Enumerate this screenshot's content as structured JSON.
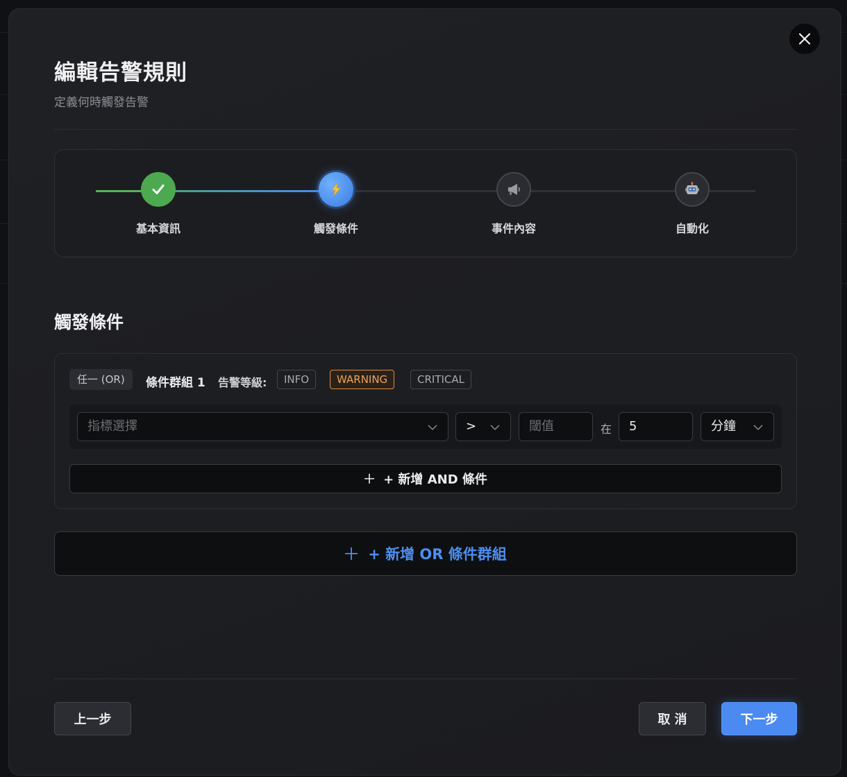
{
  "modal": {
    "title": "編輯告警規則",
    "subtitle": "定義何時觸發告警"
  },
  "steps": [
    {
      "label": "基本資訊",
      "status": "completed",
      "icon": "check-icon"
    },
    {
      "label": "觸發條件",
      "status": "active",
      "icon": "lightning-icon"
    },
    {
      "label": "事件內容",
      "status": "pending",
      "icon": "megaphone-icon"
    },
    {
      "label": "自動化",
      "status": "pending",
      "icon": "robot-icon"
    }
  ],
  "section": {
    "title": "觸發條件"
  },
  "condition_group": {
    "logic_badge": "任一 (OR)",
    "name": "條件群組 1",
    "level_label": "告警等級:",
    "levels": [
      "INFO",
      "WARNING",
      "CRITICAL"
    ],
    "selected_level": "WARNING",
    "metric_placeholder": "指標選擇",
    "operator": ">",
    "threshold_placeholder": "閾值",
    "within_label": "在",
    "duration_value": "5",
    "duration_unit": "分鐘",
    "add_and_label": "+ 新增 AND 條件"
  },
  "add_or_label": "+ 新增 OR 條件群組",
  "footer": {
    "prev_label": "上一步",
    "cancel_label": "取 消",
    "next_label": "下一步"
  },
  "colors": {
    "accent": "#4a8af1",
    "success": "#4caf50",
    "warning": "#e08e3a"
  }
}
